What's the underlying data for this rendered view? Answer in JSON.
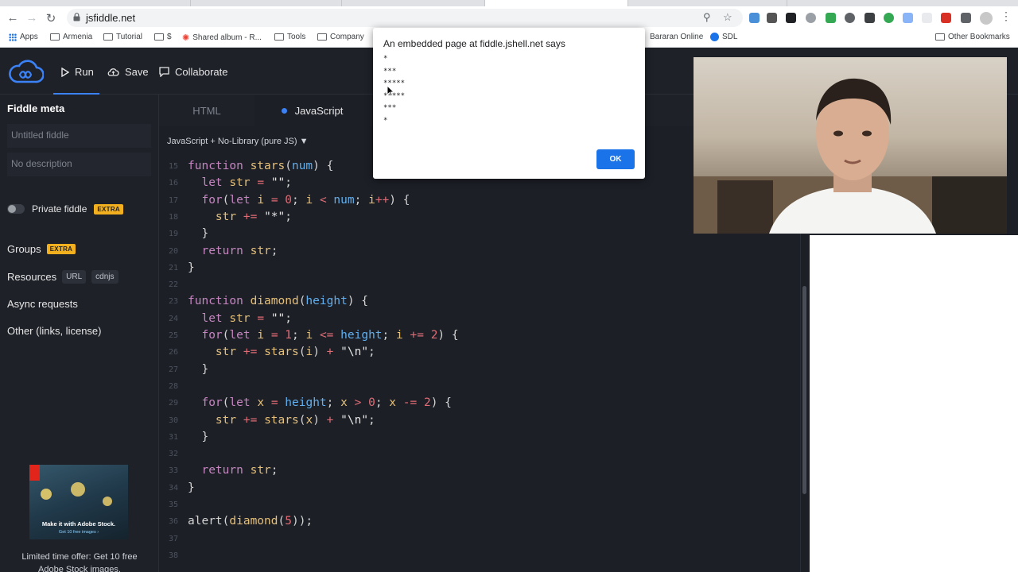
{
  "browser": {
    "url": "jsfiddle.net",
    "bookmarks": [
      {
        "label": "Apps",
        "type": "apps"
      },
      {
        "label": "Armenia",
        "type": "folder"
      },
      {
        "label": "Tutorial",
        "type": "folder"
      },
      {
        "label": "$",
        "type": "folder"
      },
      {
        "label": "Shared album - R...",
        "type": "site"
      },
      {
        "label": "Tools",
        "type": "folder"
      },
      {
        "label": "Company",
        "type": "folder"
      },
      {
        "label": "Bararan Online",
        "type": "site"
      },
      {
        "label": "SDL",
        "type": "site"
      }
    ],
    "other_bookmarks": "Other Bookmarks"
  },
  "header": {
    "run_label": "Run",
    "save_label": "Save",
    "collaborate_label": "Collaborate"
  },
  "sidebar": {
    "title": "Fiddle meta",
    "title_placeholder": "Untitled fiddle",
    "description_placeholder": "No description",
    "private_label": "Private fiddle",
    "extra_badge": "EXTRA",
    "groups_label": "Groups",
    "resources_label": "Resources",
    "resources_chips": [
      "URL",
      "cdnjs"
    ],
    "async_label": "Async requests",
    "other_label": "Other (links, license)",
    "ad": {
      "headline": "Make it with Adobe Stock.",
      "subline": "Get 10 free images ›",
      "text": "Limited time offer: Get 10 free Adobe Stock images."
    }
  },
  "editor": {
    "tabs": [
      "HTML",
      "JavaScript"
    ],
    "language": "JavaScript + No-Library (pure JS)",
    "lines": [
      {
        "n": "15",
        "code": "function stars(num) {"
      },
      {
        "n": "16",
        "code": "  let str = \"\";"
      },
      {
        "n": "17",
        "code": "  for(let i = 0; i < num; i++) {"
      },
      {
        "n": "18",
        "code": "    str += \"*\";"
      },
      {
        "n": "19",
        "code": "  }"
      },
      {
        "n": "20",
        "code": "  return str;"
      },
      {
        "n": "21",
        "code": "}"
      },
      {
        "n": "22",
        "code": ""
      },
      {
        "n": "23",
        "code": "function diamond(height) {"
      },
      {
        "n": "24",
        "code": "  let str = \"\";"
      },
      {
        "n": "25",
        "code": "  for(let i = 1; i <= height; i += 2) {"
      },
      {
        "n": "26",
        "code": "    str += stars(i) + \"\\n\";"
      },
      {
        "n": "27",
        "code": "  }"
      },
      {
        "n": "28",
        "code": ""
      },
      {
        "n": "29",
        "code": "  for(let x = height; x > 0; x -= 2) {"
      },
      {
        "n": "30",
        "code": "    str += stars(x) + \"\\n\";"
      },
      {
        "n": "31",
        "code": "  }"
      },
      {
        "n": "32",
        "code": ""
      },
      {
        "n": "33",
        "code": "  return str;"
      },
      {
        "n": "34",
        "code": "}"
      },
      {
        "n": "35",
        "code": ""
      },
      {
        "n": "36",
        "code": "alert(diamond(5));"
      },
      {
        "n": "37",
        "code": ""
      },
      {
        "n": "38",
        "code": ""
      }
    ]
  },
  "alert": {
    "title": "An embedded page at fiddle.jshell.net says",
    "message": "*\n***\n*****\n*****\n***\n*",
    "ok_label": "OK"
  },
  "colors": {
    "accent": "#3b82f6",
    "extra_badge": "#f2b01e",
    "alert_button": "#1a73e8"
  }
}
